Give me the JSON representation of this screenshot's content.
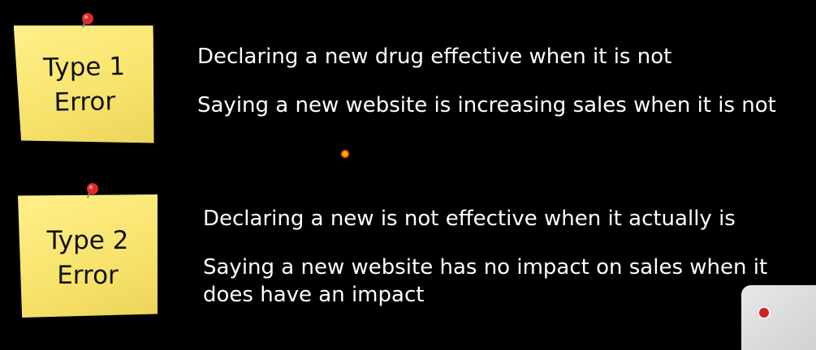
{
  "notes": [
    {
      "line1": "Type 1",
      "line2": "Error"
    },
    {
      "line1": "Type 2",
      "line2": "Error"
    }
  ],
  "type1_examples": [
    "Declaring a new drug effective when it is not",
    "Saying a new website is increasing sales when it is not"
  ],
  "type2_examples": [
    "Declaring a new is not effective when it actually is",
    "Saying a new website has no impact on sales when it",
    "does have an impact"
  ],
  "icons": [
    "pushpin-icon",
    "cursor-dot-icon"
  ],
  "colors": {
    "background": "#000000",
    "note": "#f7e26b",
    "text": "#ffffff",
    "pin": "#e02a2a"
  }
}
